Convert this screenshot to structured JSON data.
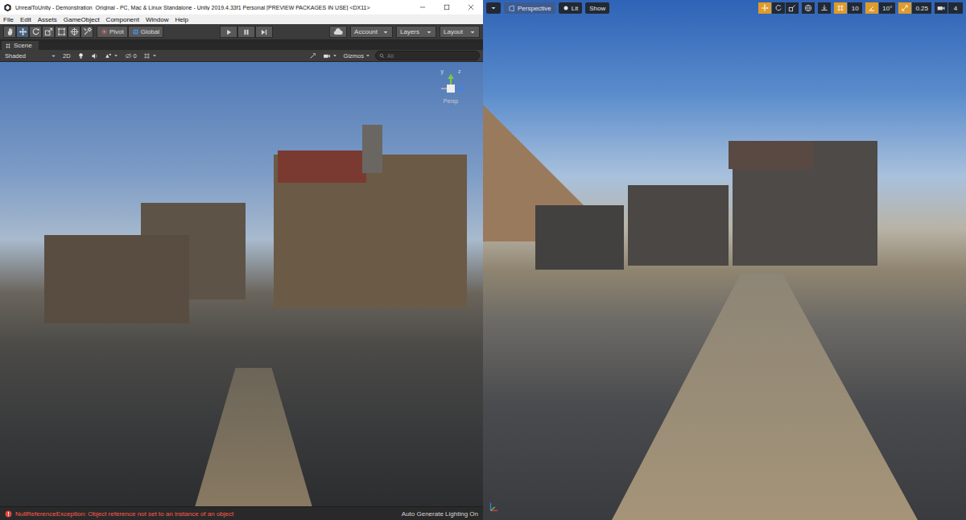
{
  "unity": {
    "window": {
      "title": "UnrealToUnity - Demonstration_Original - PC, Mac & Linux Standalone - Unity 2019.4.33f1 Personal [PREVIEW PACKAGES IN USE] <DX11>"
    },
    "menu": [
      "File",
      "Edit",
      "Assets",
      "GameObject",
      "Component",
      "Window",
      "Help"
    ],
    "toolbar": {
      "tools": [
        {
          "kind": "hand",
          "selected": false
        },
        {
          "kind": "move",
          "selected": true
        },
        {
          "kind": "rotate",
          "selected": false
        },
        {
          "kind": "scale",
          "selected": false
        },
        {
          "kind": "rect",
          "selected": false
        },
        {
          "kind": "transform",
          "selected": false
        },
        {
          "kind": "custom",
          "selected": false
        }
      ],
      "pivot": "Pivot",
      "global": "Global",
      "account": "Account",
      "layers": "Layers",
      "layout": "Layout"
    },
    "scene_tab": "Scene",
    "scene_toolbar": {
      "shading": "Shaded",
      "mode_2d": "2D",
      "hidden_count": "0",
      "gizmos": "Gizmos",
      "search": {
        "placeholder": "All"
      }
    },
    "gizmo": {
      "y": "y",
      "z": "z",
      "label": "Persp"
    },
    "status_bar": {
      "error": "NullReferenceException: Object reference not set to an instance of an object",
      "lighting": "Auto Generate Lighting On"
    }
  },
  "unreal": {
    "toolbar": {
      "perspective": "Perspective",
      "lit": "Lit",
      "show": "Show",
      "transform_tools": [
        {
          "kind": "translate",
          "selected": true
        },
        {
          "kind": "rotate",
          "selected": false
        },
        {
          "kind": "scale",
          "selected": false
        }
      ],
      "snaps": [
        {
          "kind": "grid",
          "value": "10",
          "on": true
        },
        {
          "kind": "rotation",
          "value": "10°",
          "on": true
        },
        {
          "kind": "scale",
          "value": "0.25",
          "on": true
        }
      ],
      "camera_speed": "4"
    }
  }
}
